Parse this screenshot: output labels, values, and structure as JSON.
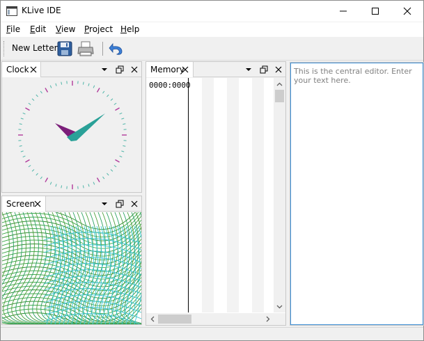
{
  "window": {
    "title": "KLive IDE"
  },
  "menu": {
    "items": [
      {
        "label": "File",
        "mnemonic": "F",
        "rest": "ile"
      },
      {
        "label": "Edit",
        "mnemonic": "E",
        "rest": "dit"
      },
      {
        "label": "View",
        "mnemonic": "V",
        "rest": "iew"
      },
      {
        "label": "Project",
        "mnemonic": "P",
        "rest": "roject"
      },
      {
        "label": "Help",
        "mnemonic": "H",
        "rest": "elp"
      }
    ]
  },
  "toolbar": {
    "new_letter_label": "New Letter",
    "icons": [
      "save-icon",
      "print-icon",
      "undo-icon"
    ]
  },
  "panels": {
    "clock": {
      "tab_label": "Clock"
    },
    "screen": {
      "tab_label": "Screen"
    },
    "memory": {
      "tab_label": "Memory",
      "address": "0000:0000"
    }
  },
  "editor": {
    "text": "This is the central editor. Enter your text here."
  },
  "colors": {
    "accent": "#3d8fd6",
    "clock_hour_hand": "#7b1f7a",
    "clock_minute_hand": "#2aa198",
    "clock_tick_minor": "#4fb5a8",
    "clock_tick_major": "#b03a9b"
  }
}
